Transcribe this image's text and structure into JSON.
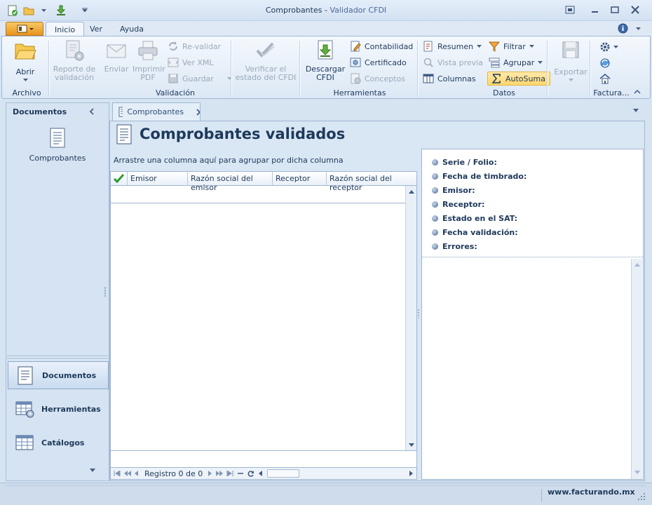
{
  "window": {
    "title": "Comprobantes",
    "separator": " - ",
    "app": "Validador CFDI"
  },
  "tabs": [
    {
      "label": "Inicio",
      "active": true
    },
    {
      "label": "Ver"
    },
    {
      "label": "Ayuda"
    }
  ],
  "ribbon": {
    "groups": {
      "archivo": "Archivo",
      "validacion": "Validación",
      "herramientas": "Herramientas",
      "datos": "Datos",
      "factura": "Factura..."
    },
    "abrir": "Abrir",
    "reporte": "Reporte de\nvalidación",
    "enviar": "Enviar",
    "imprimir": "Imprimir\nPDF",
    "revalidar": "Re-validar",
    "verxml": "Ver XML",
    "guardar": "Guardar",
    "verificar": "Verificar el\nestado del CFDI",
    "descargar": "Descargar\nCFDI",
    "contabilidad": "Contabilidad",
    "certificado": "Certificado",
    "conceptos": "Conceptos",
    "resumen": "Resumen",
    "vistaprevia": "Vista previa",
    "columnas": "Columnas",
    "filtrar": "Filtrar",
    "agrupar": "Agrupar",
    "autosuma": "AutoSuma",
    "exportar": "Exportar"
  },
  "leftpanel": {
    "header": "Documentos",
    "item": "Comprobantes",
    "nav": [
      "Documentos",
      "Herramientas",
      "Catálogos"
    ]
  },
  "doc": {
    "tab": "Comprobantes",
    "title": "Comprobantes validados",
    "grouphint": "Arrastre una columna aquí para agrupar por dicha columna",
    "columns": [
      "Emisor",
      "Razón social del emisor",
      "Receptor",
      "Razón social del receptor"
    ],
    "record": "Registro 0 de 0"
  },
  "details": [
    "Serie / Folio:",
    "Fecha de timbrado:",
    "Emisor:",
    "Receptor:",
    "Estado en el SAT:",
    "Fecha validación:",
    "Errores:"
  ],
  "status": {
    "site": "www.facturando.mx"
  }
}
